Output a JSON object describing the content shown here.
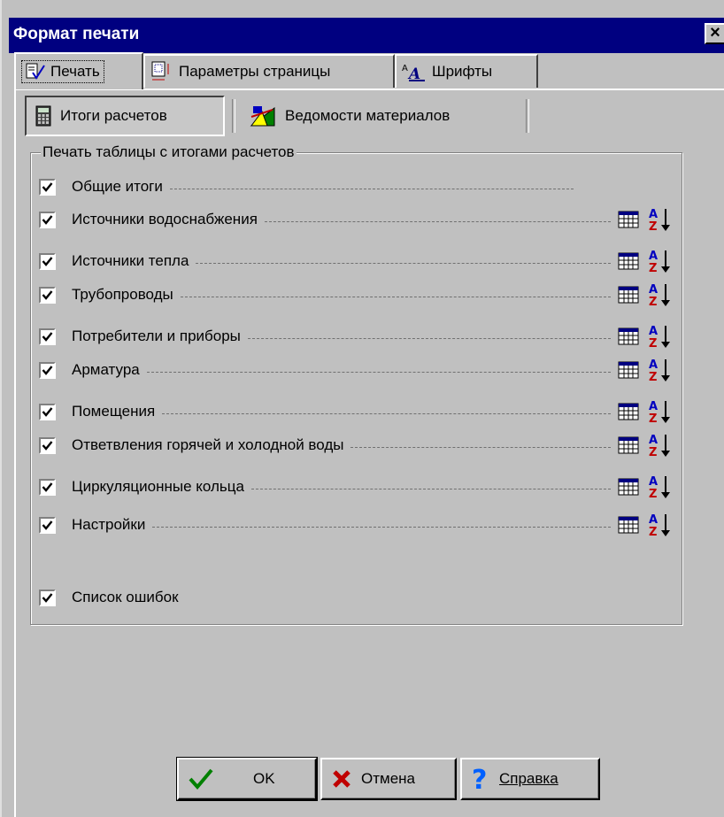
{
  "window": {
    "title": "Формат печати",
    "close": "×"
  },
  "tabs": [
    {
      "label": "Печать",
      "active": true
    },
    {
      "label": "Параметры страницы",
      "active": false
    },
    {
      "label": "Шрифты",
      "active": false
    }
  ],
  "subtabs": [
    {
      "label": "Итоги расчетов",
      "pressed": true
    },
    {
      "label": "Ведомости материалов",
      "pressed": false
    }
  ],
  "group": {
    "legend": "Печать таблицы с итогами расчетов",
    "rows": [
      {
        "label": "Общие итоги",
        "checked": true,
        "icons": false
      },
      {
        "label": "Источники водоснабжения",
        "checked": true,
        "icons": true
      },
      {
        "label": "Источники тепла",
        "checked": true,
        "icons": true
      },
      {
        "label": "Трубопроводы",
        "checked": true,
        "icons": true
      },
      {
        "label": "Потребители и приборы",
        "checked": true,
        "icons": true
      },
      {
        "label": "Арматура",
        "checked": true,
        "icons": true
      },
      {
        "label": "Помещения",
        "checked": true,
        "icons": true
      },
      {
        "label": "Ответвления горячей и холодной воды",
        "checked": true,
        "icons": true
      },
      {
        "label": "Циркуляционные кольца",
        "checked": true,
        "icons": true
      },
      {
        "label": "Настройки",
        "checked": true,
        "icons": true
      }
    ],
    "errors": {
      "label": "Список ошибок",
      "checked": true
    }
  },
  "buttons": {
    "ok": "OK",
    "cancel": "Отмена",
    "help": "Справка"
  },
  "colors": {
    "titlebar": "#000080",
    "face": "#c0c0c0",
    "sort_blue": "#0000c0",
    "sort_red": "#c00000"
  }
}
